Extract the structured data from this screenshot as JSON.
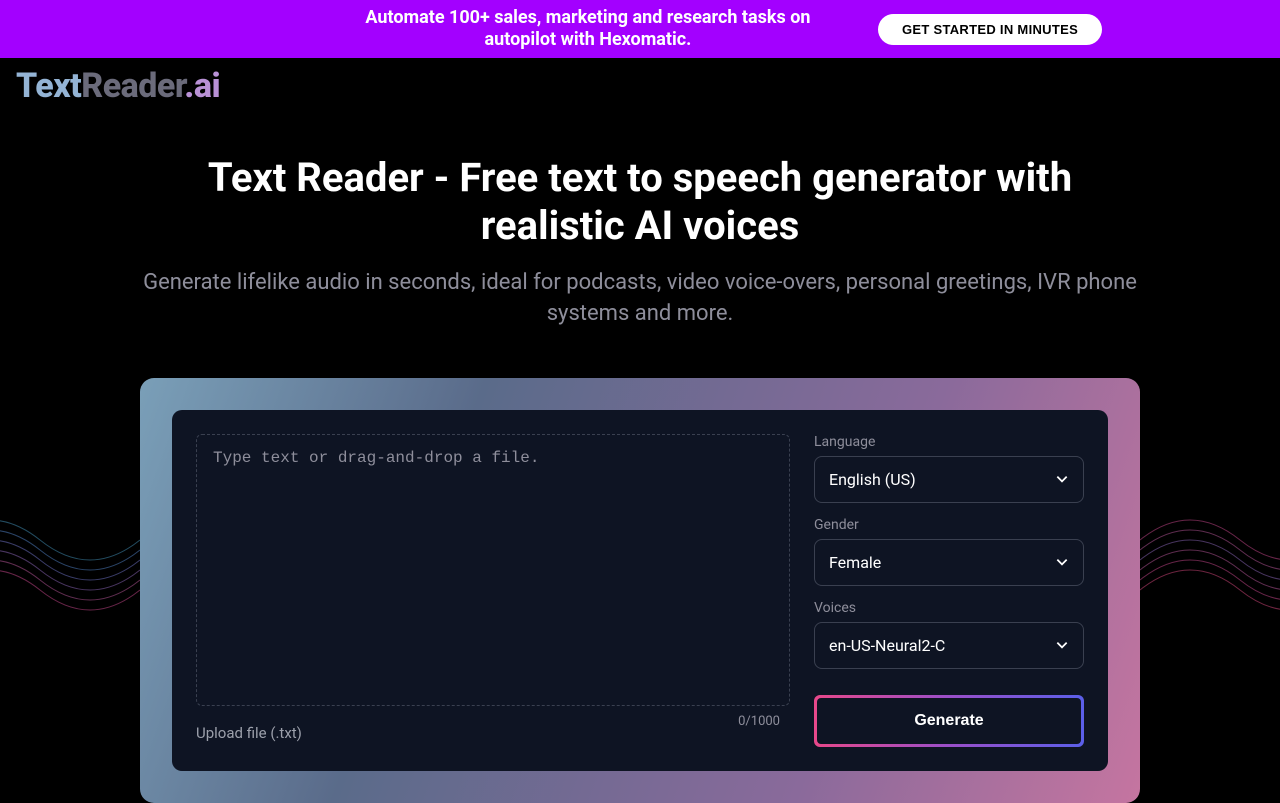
{
  "banner": {
    "text": "Automate 100+ sales, marketing and research tasks on autopilot with Hexomatic.",
    "button": "GET STARTED IN MINUTES"
  },
  "logo": {
    "part1": "Text",
    "part2": "Reader",
    "part3": ".ai"
  },
  "hero": {
    "title": "Text Reader - Free text to speech generator with realistic AI voices",
    "subtitle": "Generate lifelike audio in seconds, ideal for podcasts, video voice-overs, personal greetings, IVR phone systems and more."
  },
  "form": {
    "placeholder": "Type text or drag-and-drop a file.",
    "counter": "0/1000",
    "upload_label": "Upload file (.txt)",
    "language_label": "Language",
    "language_value": "English (US)",
    "gender_label": "Gender",
    "gender_value": "Female",
    "voices_label": "Voices",
    "voices_value": "en-US-Neural2-C",
    "generate": "Generate"
  }
}
